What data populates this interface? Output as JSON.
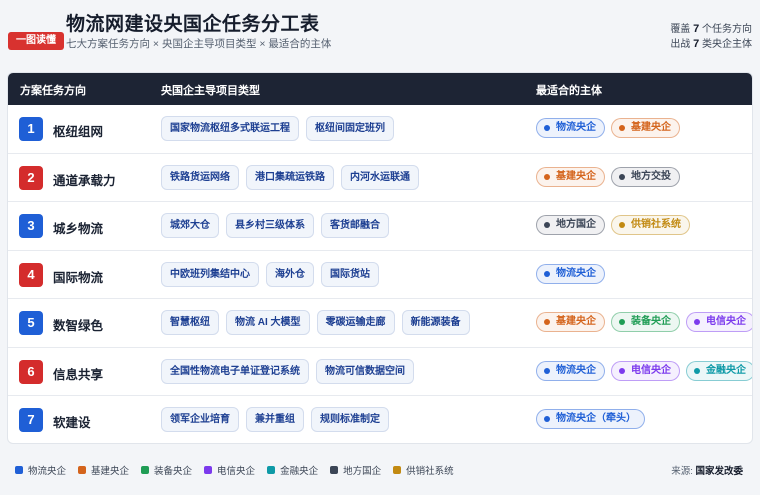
{
  "header": {
    "badge": "一图读懂",
    "title": "物流网建设央国企任务分工表",
    "subtitle": "七大方案任务方向 × 央国企主导项目类型 × 最适合的主体",
    "stat1_pre": "覆盖",
    "stat1_num": "7",
    "stat1_post": "个任务方向",
    "stat2_pre": "出战",
    "stat2_num": "7",
    "stat2_post": "类央企主体"
  },
  "columns": [
    "方案任务方向",
    "央国企主导项目类型",
    "最适合的主体"
  ],
  "colors": {
    "物流央企": "#1f5fd6",
    "基建央企": "#d4641c",
    "装备央企": "#1f9d55",
    "电信央企": "#7c3aed",
    "金融央企": "#0e9aa7",
    "地方国企": "#3b4556",
    "供销社系统": "#c28a12"
  },
  "rows": [
    {
      "num": "1",
      "color": "blue",
      "direction": "枢纽组网",
      "types": [
        "国家物流枢纽多式联运工程",
        "枢纽间固定班列"
      ],
      "entities": [
        {
          "name": "物流央企",
          "key": "物流央企"
        },
        {
          "name": "基建央企",
          "key": "基建央企"
        }
      ]
    },
    {
      "num": "2",
      "color": "red",
      "direction": "通道承载力",
      "types": [
        "铁路货运网络",
        "港口集疏运铁路",
        "内河水运联通"
      ],
      "entities": [
        {
          "name": "基建央企",
          "key": "基建央企"
        },
        {
          "name": "地方交投",
          "key": "地方国企"
        }
      ]
    },
    {
      "num": "3",
      "color": "blue",
      "direction": "城乡物流",
      "types": [
        "城郊大仓",
        "县乡村三级体系",
        "客货邮融合"
      ],
      "entities": [
        {
          "name": "地方国企",
          "key": "地方国企"
        },
        {
          "name": "供销社系统",
          "key": "供销社系统"
        }
      ]
    },
    {
      "num": "4",
      "color": "red",
      "direction": "国际物流",
      "types": [
        "中欧班列集结中心",
        "海外仓",
        "国际货站"
      ],
      "entities": [
        {
          "name": "物流央企",
          "key": "物流央企"
        }
      ]
    },
    {
      "num": "5",
      "color": "blue",
      "direction": "数智绿色",
      "types": [
        "智慧枢纽",
        "物流 AI 大模型",
        "零碳运输走廊",
        "新能源装备"
      ],
      "entities": [
        {
          "name": "基建央企",
          "key": "基建央企"
        },
        {
          "name": "装备央企",
          "key": "装备央企"
        },
        {
          "name": "电信央企",
          "key": "电信央企"
        }
      ]
    },
    {
      "num": "6",
      "color": "red",
      "direction": "信息共享",
      "types": [
        "全国性物流电子单证登记系统",
        "物流可信数据空间"
      ],
      "entities": [
        {
          "name": "物流央企",
          "key": "物流央企"
        },
        {
          "name": "电信央企",
          "key": "电信央企"
        },
        {
          "name": "金融央企",
          "key": "金融央企"
        }
      ]
    },
    {
      "num": "7",
      "color": "blue",
      "direction": "软建设",
      "types": [
        "领军企业培育",
        "兼并重组",
        "规则标准制定"
      ],
      "entities": [
        {
          "name": "物流央企（牵头）",
          "key": "物流央企"
        }
      ]
    }
  ],
  "legend": [
    "物流央企",
    "基建央企",
    "装备央企",
    "电信央企",
    "金融央企",
    "地方国企",
    "供销社系统"
  ],
  "source_label": "来源:",
  "source_value": "国家发改委"
}
